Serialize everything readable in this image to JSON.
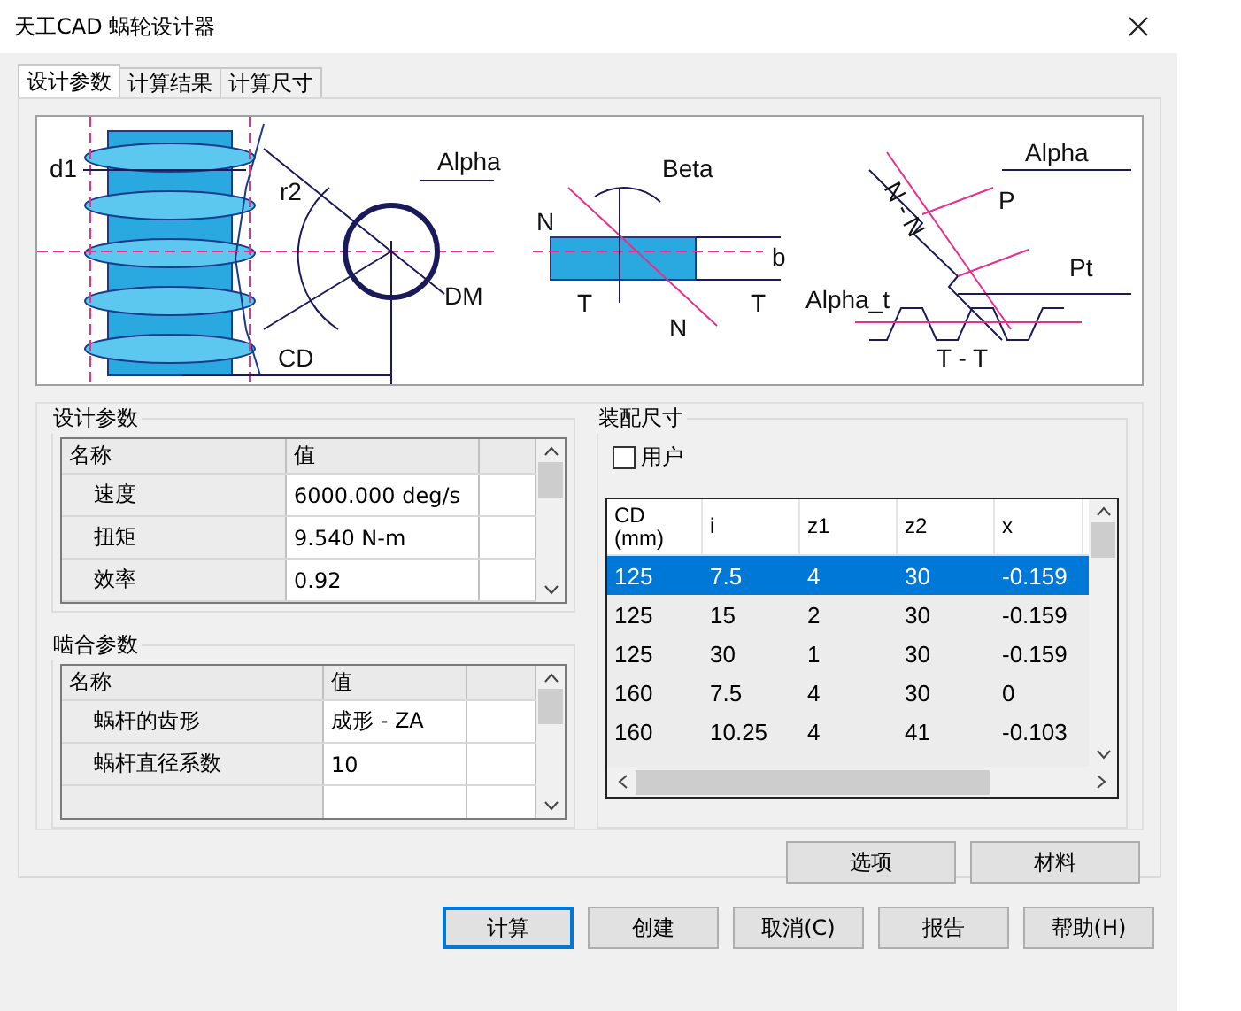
{
  "window": {
    "title": "天工CAD 蜗轮设计器"
  },
  "tabs": [
    {
      "label": "设计参数",
      "selected": true
    },
    {
      "label": "计算结果",
      "selected": false
    },
    {
      "label": "计算尺寸",
      "selected": false
    }
  ],
  "diagram": {
    "labels": [
      "d1",
      "r2",
      "Alpha",
      "DM",
      "CD",
      "Beta",
      "N",
      "N",
      "T",
      "T",
      "b",
      "Alpha",
      "N - N",
      "P",
      "Pt",
      "Alpha_t",
      "T - T"
    ]
  },
  "design_params": {
    "title": "设计参数",
    "columns": [
      "名称",
      "值"
    ],
    "rows": [
      {
        "name": "速度",
        "value": "6000.000 deg/s"
      },
      {
        "name": "扭矩",
        "value": "9.540 N-m"
      },
      {
        "name": "效率",
        "value": "0.92"
      }
    ]
  },
  "mesh_params": {
    "title": "啮合参数",
    "columns": [
      "名称",
      "值"
    ],
    "rows": [
      {
        "name": "蜗杆的齿形",
        "value": "成形 - ZA"
      },
      {
        "name": "蜗杆直径系数",
        "value": "10"
      }
    ]
  },
  "assembly": {
    "title": "装配尺寸",
    "user_checkbox": {
      "label": "用户",
      "checked": false
    },
    "columns": [
      "CD (mm)",
      "i",
      "z1",
      "z2",
      "x"
    ],
    "rows": [
      {
        "cells": [
          "125",
          "7.5",
          "4",
          "30",
          "-0.159"
        ],
        "selected": true
      },
      {
        "cells": [
          "125",
          "15",
          "2",
          "30",
          "-0.159"
        ],
        "selected": false
      },
      {
        "cells": [
          "125",
          "30",
          "1",
          "30",
          "-0.159"
        ],
        "selected": false
      },
      {
        "cells": [
          "160",
          "7.5",
          "4",
          "30",
          "0"
        ],
        "selected": false
      },
      {
        "cells": [
          "160",
          "10.25",
          "4",
          "41",
          "-0.103"
        ],
        "selected": false
      }
    ]
  },
  "side_buttons": [
    "选项",
    "材料"
  ],
  "buttons": [
    {
      "label": "计算",
      "focused": true
    },
    {
      "label": "创建",
      "focused": false
    },
    {
      "label": "取消(C)",
      "focused": false
    },
    {
      "label": "报告",
      "focused": false
    },
    {
      "label": "帮助(H)",
      "focused": false
    }
  ]
}
